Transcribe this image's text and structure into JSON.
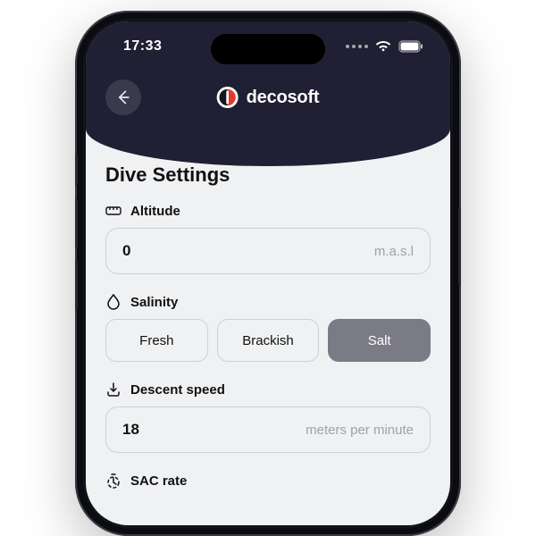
{
  "status": {
    "time": "17:33"
  },
  "brand": {
    "name": "decosoft"
  },
  "page": {
    "title": "Dive Settings"
  },
  "altitude": {
    "label": "Altitude",
    "value": "0",
    "unit": "m.a.s.l"
  },
  "salinity": {
    "label": "Salinity",
    "options": [
      "Fresh",
      "Brackish",
      "Salt"
    ],
    "selected_index": 2
  },
  "descent": {
    "label": "Descent speed",
    "value": "18",
    "unit": "meters per minute"
  },
  "sac": {
    "label": "SAC rate"
  }
}
